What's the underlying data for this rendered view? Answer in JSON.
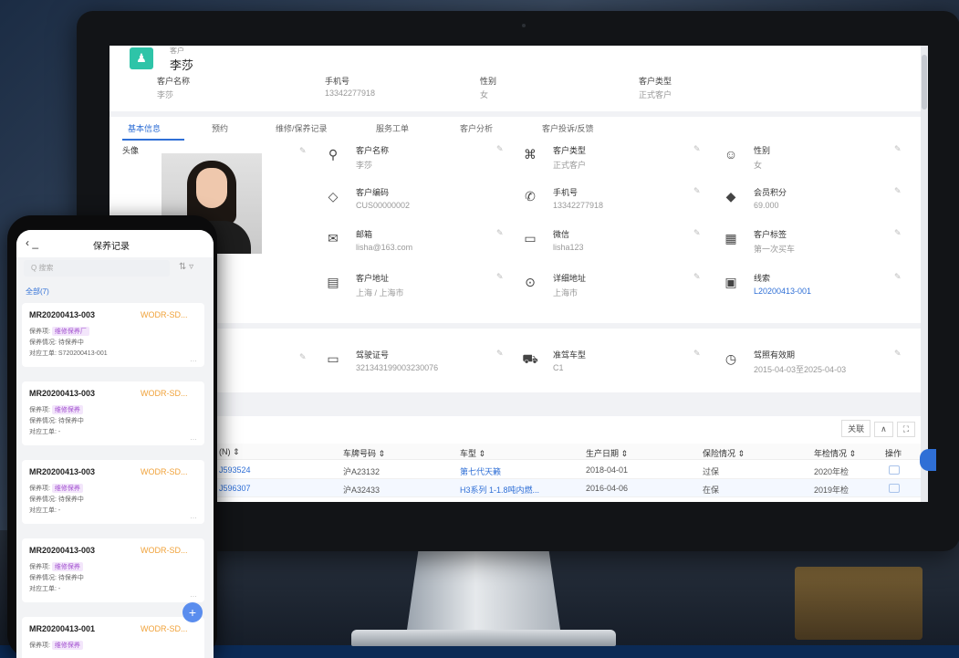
{
  "colors": {
    "accent": "#2f6fd6",
    "teal": "#2ec4a8",
    "orange": "#f0a23a",
    "purple": "#a352d0"
  },
  "header": {
    "caption": "客户",
    "name": "李莎",
    "fields": [
      {
        "label": "客户名称",
        "value": "李莎"
      },
      {
        "label": "手机号",
        "value": "13342277918"
      },
      {
        "label": "性别",
        "value": "女"
      },
      {
        "label": "客户类型",
        "value": "正式客户"
      }
    ]
  },
  "tabs": [
    "基本信息",
    "预约",
    "维修/保养记录",
    "服务工单",
    "客户分析",
    "客户投诉/反馈"
  ],
  "info": {
    "photo_label": "头像",
    "cells": [
      {
        "icon": "user-icon",
        "glyph": "⚲",
        "label": "客户名称",
        "value": "李莎"
      },
      {
        "icon": "id-scan-icon",
        "glyph": "⌘",
        "label": "客户类型",
        "value": "正式客户"
      },
      {
        "icon": "gender-icon",
        "glyph": "☺",
        "label": "性别",
        "value": "女"
      },
      {
        "icon": "tag-icon",
        "glyph": "◇",
        "label": "客户编码",
        "value": "CUS00000002"
      },
      {
        "icon": "phone-icon",
        "glyph": "✆",
        "label": "手机号",
        "value": "13342277918"
      },
      {
        "icon": "diamond-icon",
        "glyph": "◆",
        "label": "会员积分",
        "value": "69.000"
      },
      {
        "icon": "mail-icon",
        "glyph": "✉",
        "label": "邮箱",
        "value": "lisha@163.com"
      },
      {
        "icon": "wechat-icon",
        "glyph": "▭",
        "label": "微信",
        "value": "lisha123"
      },
      {
        "icon": "grid-tag-icon",
        "glyph": "▦",
        "label": "客户标签",
        "value": "第一次买车"
      },
      {
        "icon": "building-icon",
        "glyph": "▤",
        "label": "客户地址",
        "value": "上海 / 上海市"
      },
      {
        "icon": "location-icon",
        "glyph": "⊙",
        "label": "详细地址",
        "value": "上海市"
      },
      {
        "icon": "card-icon",
        "glyph": "▣",
        "label": "线索",
        "value": "L20200413-001"
      },
      {
        "icon": "license-icon",
        "glyph": "▭",
        "label": "驾驶证号",
        "value": "321343199003230076"
      },
      {
        "icon": "car-icon",
        "glyph": "⛟",
        "label": "准驾车型",
        "value": "C1"
      },
      {
        "icon": "clock-icon",
        "glyph": "◷",
        "label": "驾照有效期",
        "value": "2015-04-03至2025-04-03"
      }
    ]
  },
  "grid": {
    "buttons": [
      "关联",
      "∧",
      "⛶"
    ],
    "headers": [
      "(N) ⇕",
      "车牌号码 ⇕",
      "车型 ⇕",
      "生产日期 ⇕",
      "保险情况 ⇕",
      "年检情况 ⇕",
      "操作"
    ],
    "rows": [
      [
        "J593524",
        "沪A23132",
        "第七代天籁",
        "2018-04-01",
        "过保",
        "2020年检"
      ],
      [
        "J596307",
        "沪A32433",
        "H3系列 1-1.8吨内燃...",
        "2016-04-06",
        "在保",
        "2019年检"
      ]
    ]
  },
  "phone": {
    "title": "保养记录",
    "back": "‹ _",
    "search_placeholder": "Q 搜索",
    "all_label": "全部(7)",
    "cards": [
      {
        "no": "MR20200413-003",
        "tag": "WODR-SD...",
        "l1": "保养项:",
        "pill": "维修保养厂",
        "l2": "保养情况: 待保养中",
        "l3": "对应工单: S720200413-001"
      },
      {
        "no": "MR20200413-003",
        "tag": "WODR-SD...",
        "l1": "保养项:",
        "pill": "维修保养",
        "l2": "保养情况: 待保养中",
        "l3": "对应工单: -"
      },
      {
        "no": "MR20200413-003",
        "tag": "WODR-SD...",
        "l1": "保养项:",
        "pill": "维修保养",
        "l2": "保养情况: 待保养中",
        "l3": "对应工单: -"
      },
      {
        "no": "MR20200413-003",
        "tag": "WODR-SD...",
        "l1": "保养项:",
        "pill": "维修保养",
        "l2": "保养情况: 待保养中",
        "l3": "对应工单: -"
      },
      {
        "no": "MR20200413-001",
        "tag": "WODR-SD...",
        "l1": "保养项:",
        "pill": "维修保养",
        "l2": "",
        "l3": ""
      }
    ],
    "fab": "+"
  }
}
